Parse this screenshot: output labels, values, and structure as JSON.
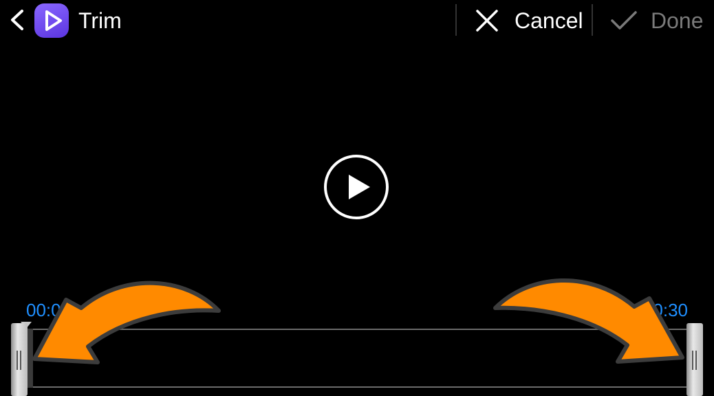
{
  "header": {
    "title": "Trim",
    "cancel_label": "Cancel",
    "done_label": "Done"
  },
  "trim": {
    "start_time": "00:00",
    "end_time": "00:30"
  },
  "colors": {
    "accent_time": "#1f8fff",
    "annotation_arrow": "#ff8a00",
    "done_disabled": "#7a7a7a"
  }
}
